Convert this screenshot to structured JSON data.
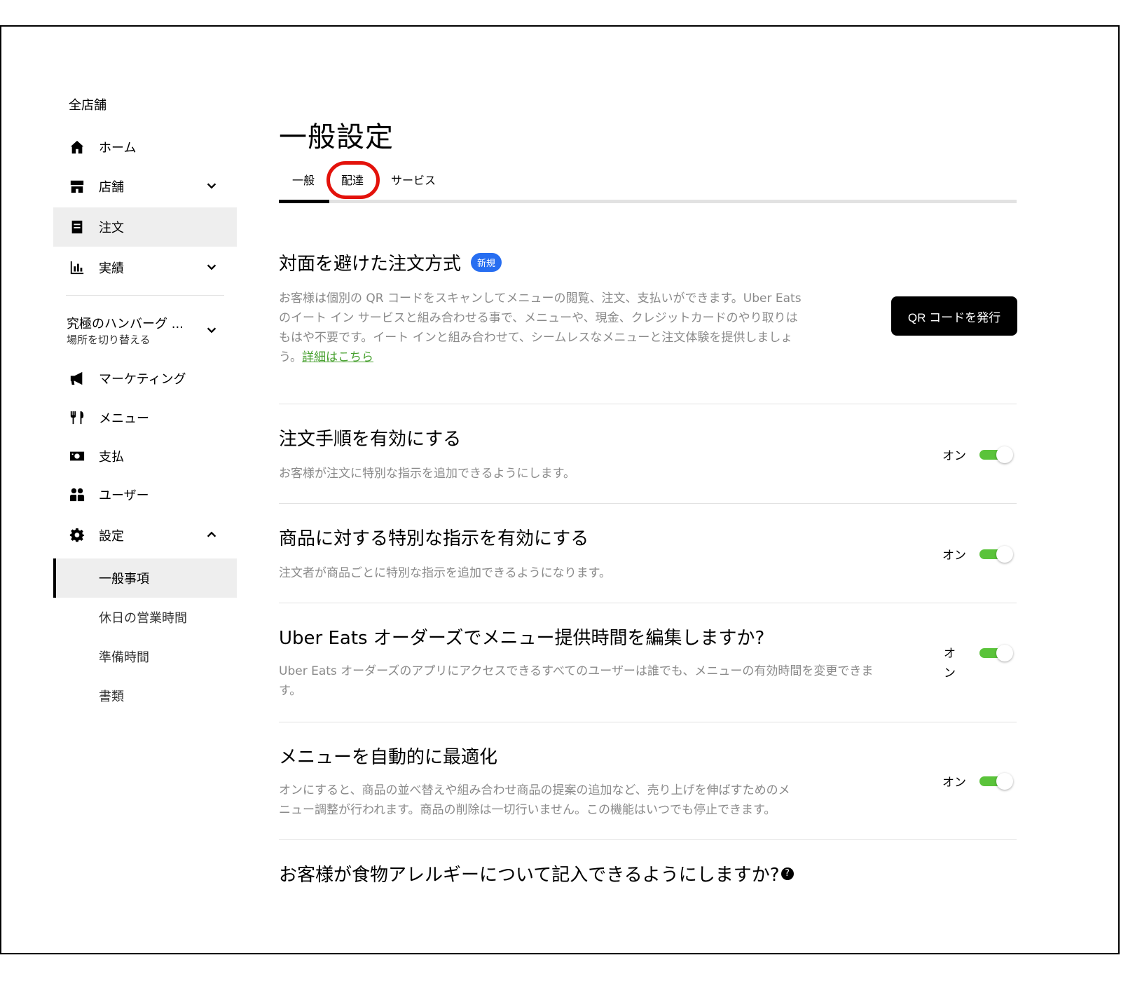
{
  "sidebar": {
    "header": "全店舗",
    "items": [
      {
        "label": "ホーム",
        "icon": "home-icon"
      },
      {
        "label": "店舗",
        "icon": "store-icon"
      },
      {
        "label": "注文",
        "icon": "receipt-icon"
      },
      {
        "label": "実績",
        "icon": "bar-chart-icon"
      }
    ],
    "store": {
      "name": "究極のハンバーグ ...",
      "switch_label": "場所を切り替える"
    },
    "items2": [
      {
        "label": "マーケティング",
        "icon": "megaphone-icon"
      },
      {
        "label": "メニュー",
        "icon": "utensils-icon"
      },
      {
        "label": "支払",
        "icon": "money-icon"
      },
      {
        "label": "ユーザー",
        "icon": "users-icon"
      },
      {
        "label": "設定",
        "icon": "gear-icon"
      }
    ],
    "settings_sub": [
      "一般事項",
      "休日の営業時間",
      "準備時間",
      "書類"
    ]
  },
  "main": {
    "title": "一般設定",
    "tabs": [
      "一般",
      "配達",
      "サービス"
    ],
    "contactless": {
      "title": "対面を避けた注文方式",
      "badge": "新規",
      "desc_lines": [
        "お客様は個別の QR コードをスキャンしてメニューの閲覧、注文、支払いができます。Uber Eats",
        "のイート イン サービスと組み合わせる事で、メニューや、現金、クレジットカードのやり取りは",
        "もはや不要です。イート インと組み合わせて、シームレスなメニューと注文体験を提供しましょ"
      ],
      "desc_last": "う。",
      "link": "詳細はこちら",
      "button": "QR コードを発行"
    },
    "settings": [
      {
        "title": "注文手順を有効にする",
        "desc": "お客様が注文に特別な指示を追加できるようにします。",
        "toggle": "オン"
      },
      {
        "title": "商品に対する特別な指示を有効にする",
        "desc": "注文者が商品ごとに特別な指示を追加できるようになります。",
        "toggle": "オン"
      },
      {
        "title": "Uber Eats オーダーズでメニュー提供時間を編集しますか?",
        "desc1": "Uber Eats オーダーズのアプリにアクセスできるすべてのユーザーは誰でも、メニューの有効時間を変更できま",
        "desc2": "す。",
        "toggle1": "オ",
        "toggle2": "ン"
      },
      {
        "title": "メニューを自動的に最適化",
        "desc1": "オンにすると、商品の並べ替えや組み合わせ商品の提案の追加など、売り上げを伸ばすためのメ",
        "desc2": "ニュー調整が行われます。商品の削除は一切行いません。この機能はいつでも停止できます。",
        "toggle": "オン"
      }
    ],
    "allergy": {
      "title": "お客様が食物アレルギーについて記入できるようにしますか?",
      "help": "?"
    }
  }
}
